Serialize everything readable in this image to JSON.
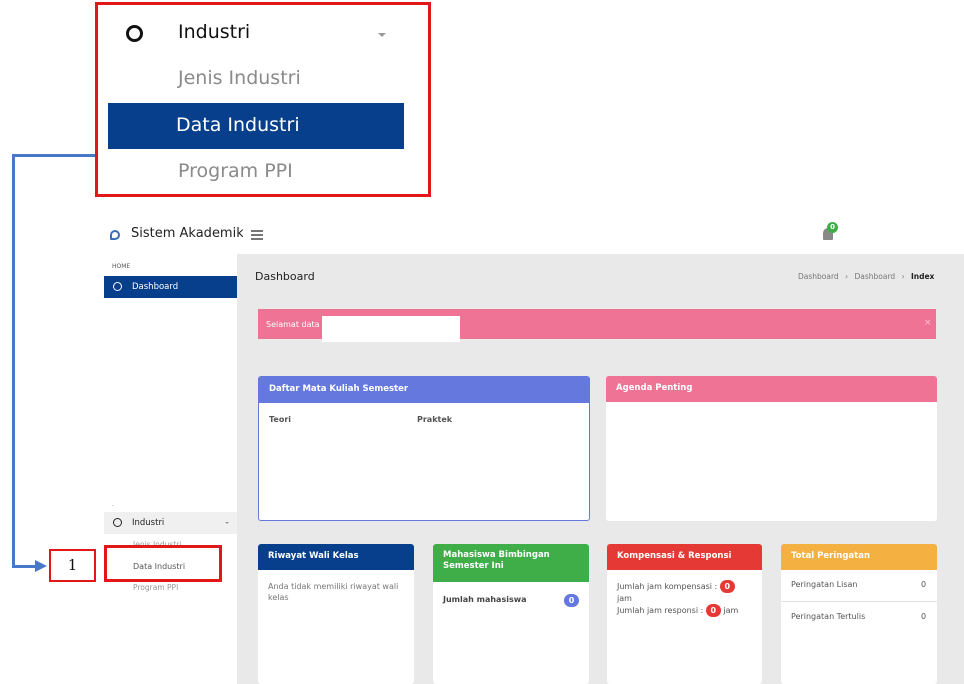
{
  "callout": {
    "group_label": "Industri",
    "items": [
      "Jenis Industri",
      "Data Industri",
      "Program PPI"
    ],
    "number": "1"
  },
  "app": {
    "brand": "Sistem Akademik",
    "notif_count": "0",
    "sidebar": {
      "section": "HOME",
      "dashboard": "Dashboard",
      "dot": "-",
      "group": "Industri",
      "items": [
        "Jenis Industri",
        "Data Industri",
        "Program PPI"
      ]
    },
    "page_title": "Dashboard",
    "breadcrumb": [
      "Dashboard",
      "Dashboard",
      "Index"
    ],
    "welcome": "Selamat data",
    "cards": {
      "mata_kuliah": {
        "title": "Daftar Mata Kuliah Semester",
        "col1": "Teori",
        "col2": "Praktek"
      },
      "agenda": {
        "title": "Agenda Penting"
      },
      "wali": {
        "title": "Riwayat Wali Kelas",
        "text": "Anda tidak memiliki riwayat wali kelas"
      },
      "bimbingan": {
        "title": "Mahasiswa Bimbingan Semester Ini",
        "label": "Jumlah mahasiswa",
        "count": "0"
      },
      "kompensasi": {
        "title": "Kompensasi & Responsi",
        "line1a": "Jumlah jam kompensasi :",
        "val1": "0",
        "line1b": "jam",
        "line2a": "Jumlah jam responsi :",
        "val2": "0",
        "line2b": "jam"
      },
      "peringatan": {
        "title": "Total Peringatan",
        "row1": "Peringatan Lisan",
        "val1": "0",
        "row2": "Peringatan Tertulis",
        "val2": "0"
      }
    }
  },
  "colors": {
    "navy": "#073f8c",
    "pink": "#ef7395",
    "blue": "#6478dd",
    "green": "#3fae49",
    "red": "#e53935",
    "orange": "#f5b042",
    "callout_red": "#e01818"
  }
}
